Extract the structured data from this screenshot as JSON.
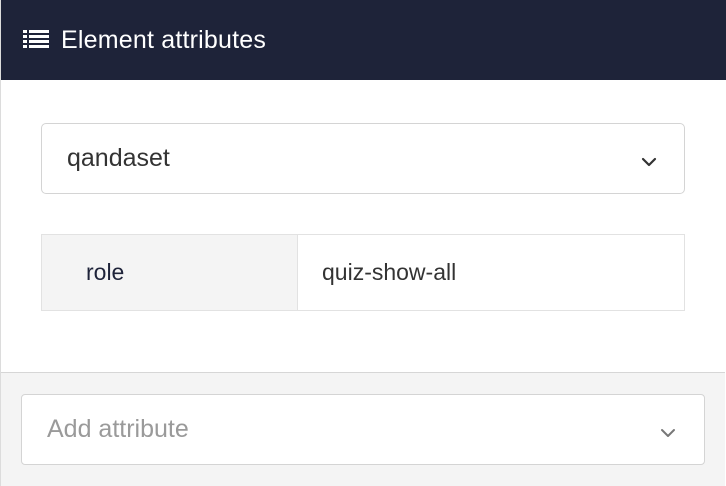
{
  "header": {
    "icon": "list-icon",
    "title": "Element attributes"
  },
  "element_select": {
    "value": "qandaset",
    "icon": "chevron-down-icon"
  },
  "attributes": [
    {
      "name": "role",
      "value": "quiz-show-all"
    }
  ],
  "add_attribute": {
    "placeholder": "Add attribute",
    "icon": "chevron-down-icon"
  },
  "colors": {
    "header_bg": "#1e2339",
    "header_text": "#ffffff",
    "attr_name_text": "#1e2339",
    "footer_bg": "#f4f4f4"
  }
}
